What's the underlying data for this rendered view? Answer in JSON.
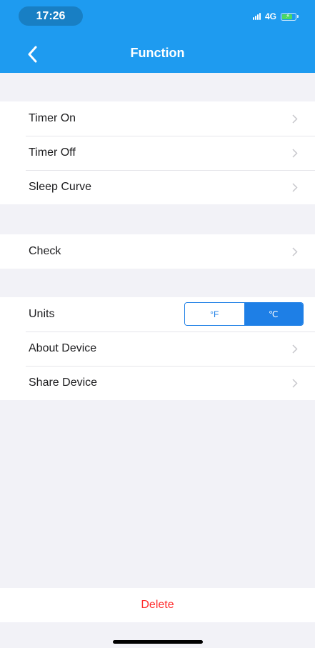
{
  "status_bar": {
    "time": "17:26",
    "network": "4G"
  },
  "header": {
    "title": "Function"
  },
  "groups": {
    "timers": [
      {
        "label": "Timer On"
      },
      {
        "label": "Timer Off"
      },
      {
        "label": "Sleep Curve"
      }
    ],
    "check": {
      "label": "Check"
    },
    "device": {
      "units_label": "Units",
      "unit_f": "°F",
      "unit_c": "℃",
      "selected_unit": "℃",
      "about_label": "About Device",
      "share_label": "Share Device"
    }
  },
  "footer": {
    "delete_label": "Delete"
  },
  "colors": {
    "header_bg": "#1e9bf0",
    "toggle_accent": "#1e7fe6",
    "delete_text": "#ff2d2d",
    "background": "#f2f2f7"
  },
  "icons": {
    "back": "chevron-left-icon",
    "row_arrow": "chevron-right-icon",
    "signal": "signal-icon",
    "battery": "battery-charging-icon"
  }
}
